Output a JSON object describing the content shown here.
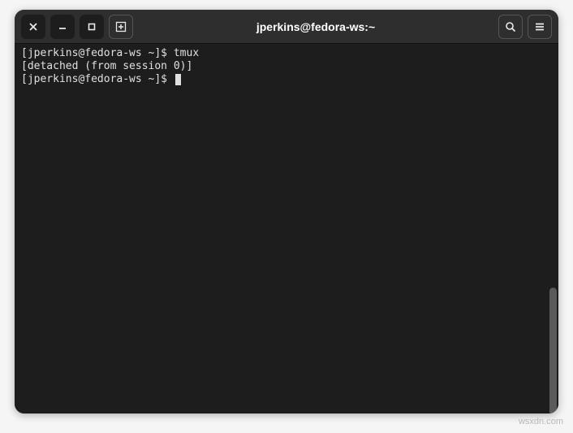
{
  "window": {
    "title": "jperkins@fedora-ws:~"
  },
  "terminal": {
    "lines": [
      "[jperkins@fedora-ws ~]$ tmux",
      "[detached (from session 0)]",
      "[jperkins@fedora-ws ~]$ "
    ]
  },
  "watermark": "wsxdn.com"
}
